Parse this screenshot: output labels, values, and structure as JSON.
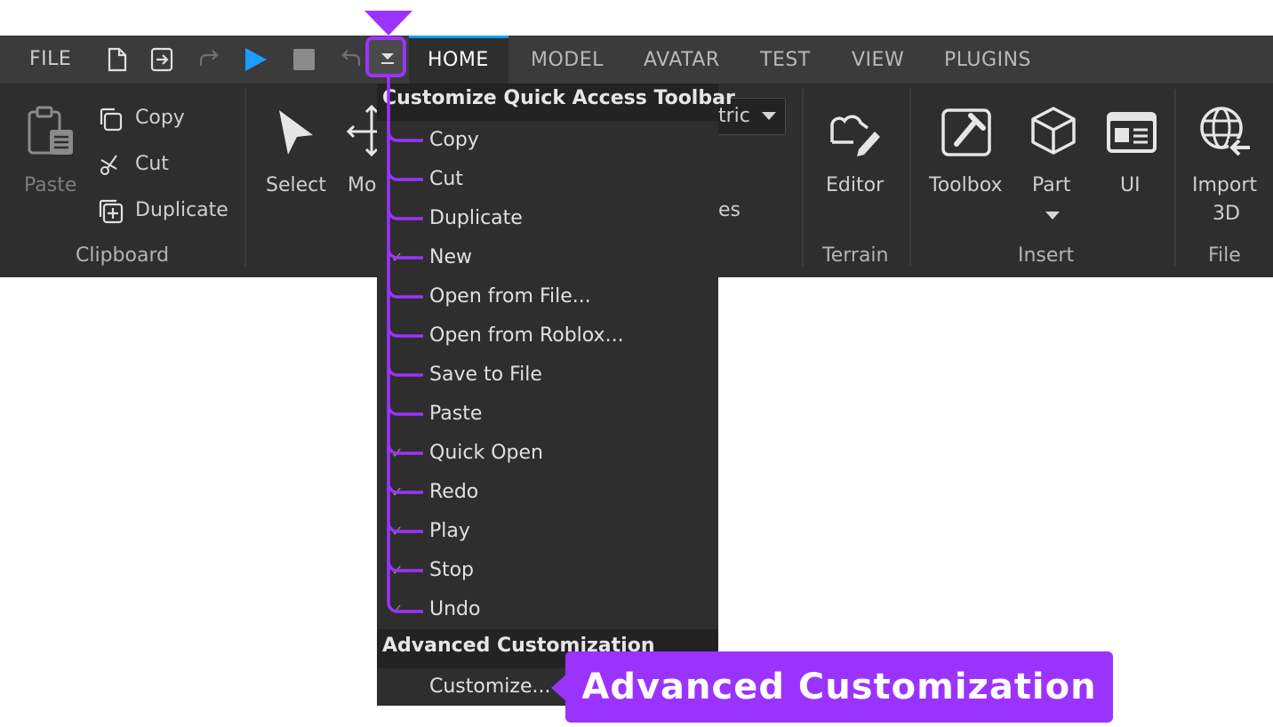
{
  "topbar": {
    "file_label": "FILE",
    "tabs": [
      {
        "label": "HOME",
        "active": true
      },
      {
        "label": "MODEL",
        "active": false
      },
      {
        "label": "AVATAR",
        "active": false
      },
      {
        "label": "TEST",
        "active": false
      },
      {
        "label": "VIEW",
        "active": false
      },
      {
        "label": "PLUGINS",
        "active": false
      }
    ],
    "accent_color": "#00a2ff"
  },
  "ribbon": {
    "clipboard": {
      "paste": "Paste",
      "copy": "Copy",
      "cut": "Cut",
      "duplicate": "Duplicate",
      "group_label": "Clipboard"
    },
    "tools": {
      "select": "Select",
      "move_partial": "Mo",
      "dropdown_partial": "tric",
      "partial_label": "es"
    },
    "terrain": {
      "editor": "Editor",
      "group_label": "Terrain"
    },
    "insert": {
      "toolbox": "Toolbox",
      "part": "Part",
      "ui": "UI",
      "group_label": "Insert"
    },
    "file": {
      "import_line1": "Import",
      "import_line2": "3D",
      "group_label": "File"
    }
  },
  "menu": {
    "header": "Customize Quick Access Toolbar",
    "items": [
      {
        "label": "Copy",
        "checked": false
      },
      {
        "label": "Cut",
        "checked": false
      },
      {
        "label": "Duplicate",
        "checked": false
      },
      {
        "label": "New",
        "checked": true
      },
      {
        "label": "Open from File...",
        "checked": false
      },
      {
        "label": "Open from Roblox...",
        "checked": false
      },
      {
        "label": "Save to File",
        "checked": false
      },
      {
        "label": "Paste",
        "checked": false
      },
      {
        "label": "Quick Open",
        "checked": true
      },
      {
        "label": "Redo",
        "checked": true
      },
      {
        "label": "Play",
        "checked": true
      },
      {
        "label": "Stop",
        "checked": true
      },
      {
        "label": "Undo",
        "checked": true
      }
    ],
    "advanced_header": "Advanced Customization",
    "customize_item": "Customize..."
  },
  "callout": {
    "text": "Advanced Customization",
    "color": "#9b33ff"
  }
}
